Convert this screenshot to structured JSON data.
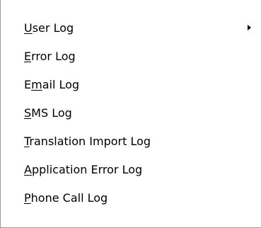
{
  "menu": {
    "items": [
      {
        "pre": "",
        "mnemonic": "U",
        "post": "ser Log",
        "has_submenu": true
      },
      {
        "pre": "",
        "mnemonic": "E",
        "post": "rror Log",
        "has_submenu": false
      },
      {
        "pre": "E",
        "mnemonic": "m",
        "post": "ail Log",
        "has_submenu": false
      },
      {
        "pre": "",
        "mnemonic": "S",
        "post": "MS Log",
        "has_submenu": false
      },
      {
        "pre": "",
        "mnemonic": "T",
        "post": "ranslation Import Log",
        "has_submenu": false
      },
      {
        "pre": "",
        "mnemonic": "A",
        "post": "pplication Error Log",
        "has_submenu": false
      },
      {
        "pre": "",
        "mnemonic": "P",
        "post": "hone Call Log",
        "has_submenu": false
      }
    ],
    "submenu_icon": "chevron-right-icon"
  }
}
